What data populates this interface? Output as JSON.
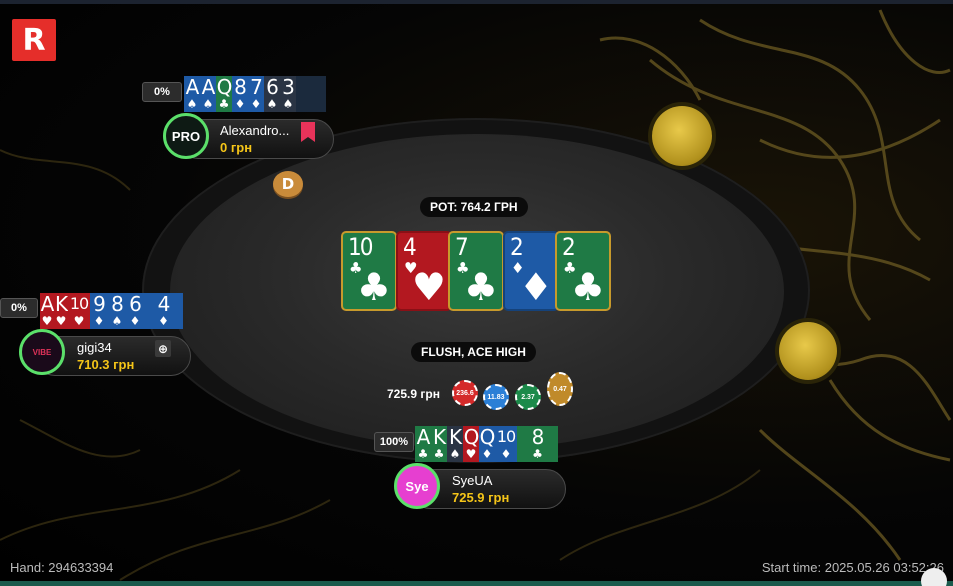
{
  "brand": {
    "logo_letter": "R",
    "accent": "#e52e2a"
  },
  "pot": {
    "label": "POT: 764.2 ГРН"
  },
  "board": [
    {
      "rank": "10",
      "suit": "♣",
      "color": "green"
    },
    {
      "rank": "4",
      "suit": "♥",
      "color": "red"
    },
    {
      "rank": "7",
      "suit": "♣",
      "color": "green"
    },
    {
      "rank": "2",
      "suit": "♦",
      "color": "blue"
    },
    {
      "rank": "2",
      "suit": "♣",
      "color": "green"
    }
  ],
  "hand_result": "FLUSH, ACE HIGH",
  "dealer_label": "D",
  "winner_chips": {
    "amount": "725.9 грн",
    "chips": [
      {
        "value": "236.6",
        "color": "#d42a2a"
      },
      {
        "value": "11.83",
        "color": "#2b7fd6"
      },
      {
        "value": "2.37",
        "color": "#1c8a4a"
      },
      {
        "value": "0.47",
        "color": "#c08a2a"
      }
    ]
  },
  "players": {
    "top": {
      "name": "Alexandro...",
      "stack": "0 грн",
      "equity": "0%",
      "avatar_text": "PRO",
      "cards": [
        {
          "r": "A",
          "s": "♠",
          "c": "blue"
        },
        {
          "r": "A",
          "s": "♠",
          "c": "blue"
        },
        {
          "r": "Q",
          "s": "♣",
          "c": "green"
        },
        {
          "r": "8",
          "s": "♦",
          "c": "blue"
        },
        {
          "r": "7",
          "s": "♦",
          "c": "blue"
        },
        {
          "r": "6",
          "s": "♠",
          "c": "dark"
        },
        {
          "r": "3",
          "s": "♠",
          "c": "dark"
        }
      ]
    },
    "left": {
      "name": "gigi34",
      "stack": "710.3 грн",
      "equity": "0%",
      "avatar_text": "VIBE",
      "cards": [
        {
          "r": "A",
          "s": "♥",
          "c": "red"
        },
        {
          "r": "K",
          "s": "♥",
          "c": "red"
        },
        {
          "r": "10",
          "s": "♥",
          "c": "red"
        },
        {
          "r": "9",
          "s": "♦",
          "c": "blue"
        },
        {
          "r": "8",
          "s": "♠",
          "c": "blue"
        },
        {
          "r": "6",
          "s": "♦",
          "c": "blue"
        },
        {
          "r": "4",
          "s": "♦",
          "c": "blue"
        }
      ]
    },
    "bottom": {
      "name": "SyeUA",
      "stack": "725.9 грн",
      "equity": "100%",
      "avatar_text": "Sye",
      "cards": [
        {
          "r": "A",
          "s": "♣",
          "c": "green"
        },
        {
          "r": "K",
          "s": "♣",
          "c": "green"
        },
        {
          "r": "K",
          "s": "♠",
          "c": "dark"
        },
        {
          "r": "Q",
          "s": "♥",
          "c": "red"
        },
        {
          "r": "Q",
          "s": "♦",
          "c": "blue"
        },
        {
          "r": "10",
          "s": "♦",
          "c": "blue"
        },
        {
          "r": "8",
          "s": "♣",
          "c": "green"
        }
      ]
    }
  },
  "footer": {
    "hand": "Hand: 294633394",
    "start_time": "Start time: 2025.05.26 03:52:26"
  }
}
